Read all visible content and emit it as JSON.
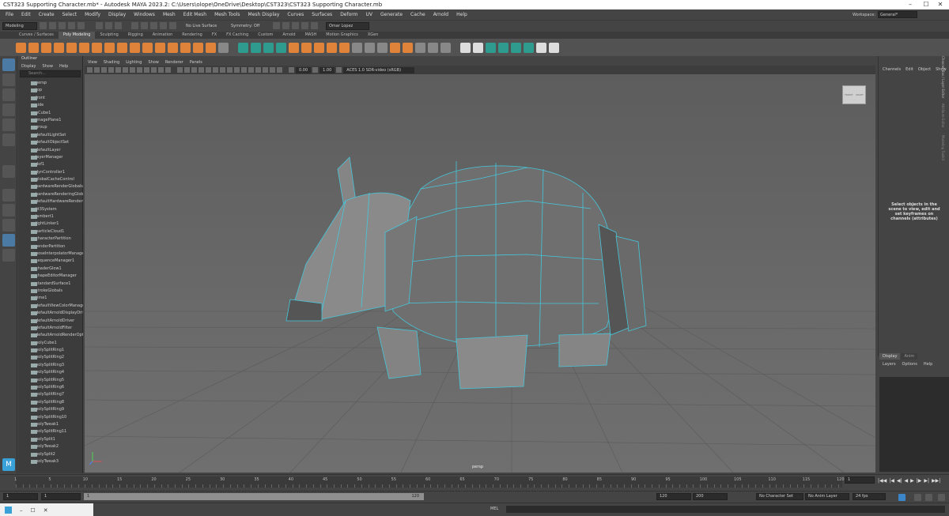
{
  "window": {
    "title": "CST323 Supporting Character.mb* - Autodesk MAYA 2023.2: C:\\Users\\olope\\OneDrive\\Desktop\\CST323\\CST323 Supporting Character.mb",
    "minimize": "–",
    "maximize": "☐",
    "close": "✕"
  },
  "menu": [
    "File",
    "Edit",
    "Create",
    "Select",
    "Modify",
    "Display",
    "Windows",
    "Mesh",
    "Edit Mesh",
    "Mesh Tools",
    "Mesh Display",
    "Curves",
    "Surfaces",
    "Deform",
    "UV",
    "Generate",
    "Cache",
    "Arnold",
    "Help"
  ],
  "workspace": {
    "label": "Workspace:",
    "value": "General*"
  },
  "statusline": {
    "mode": "Modeling",
    "live_surface": "No Live Surface",
    "symmetry": "Symmetry: Off",
    "user": "Omar Lopez"
  },
  "shelf_tabs": [
    "Curves / Surfaces",
    "Poly Modeling",
    "Sculpting",
    "Rigging",
    "Animation",
    "Rendering",
    "FX",
    "FX Caching",
    "Custom",
    "Arnold",
    "MASH",
    "Motion Graphics",
    "XGen"
  ],
  "shelf_active": "Poly Modeling",
  "outliner": {
    "title": "Outliner",
    "menu": [
      "Display",
      "Show",
      "Help"
    ],
    "search_placeholder": "Search...",
    "items": [
      "persp",
      "top",
      "front",
      "side",
      "pCube1",
      "imagePlane1",
      "group",
      "defaultLightSet",
      "defaultObjectSet",
      "defaultLayer",
      "layerManager",
      "dof1",
      "dynController1",
      "globalCacheControl",
      "hardwareRenderGlobals",
      "hardwareRenderingGlobals",
      "defaultHardwareRenderGlobals",
      "lit3System",
      "lambert1",
      "lightLinker1",
      "particleCloud1",
      "characterPartition",
      "renderPartition",
      "poseInterpolatorManager",
      "sequenceManager1",
      "shaderGlow1",
      "shapeEditorManager",
      "standardSurface1",
      "strokeGlobals",
      "time1",
      "defaultViewColorManager",
      "defaultArnoldDisplayDriver",
      "defaultArnoldDriver",
      "defaultArnoldFilter",
      "defaultArnoldRenderOptions",
      "polyCube1",
      "polySplitRing1",
      "polySplitRing2",
      "polySplitRing3",
      "polySplitRing4",
      "polySplitRing5",
      "polySplitRing6",
      "polySplitRing7",
      "polySplitRing8",
      "polySplitRing9",
      "polySplitRing10",
      "polyTweak1",
      "polySplitRing11",
      "polySplit1",
      "polyTweak2",
      "polySplit2",
      "polyTweak3"
    ]
  },
  "viewport": {
    "menu": [
      "View",
      "Shading",
      "Lighting",
      "Show",
      "Renderer",
      "Panels"
    ],
    "exposure": "0.00",
    "gamma": "1.00",
    "color_space": "ACES 1.0 SDR-video (sRGB)",
    "camera": "persp",
    "viewcube": [
      "FRONT",
      "RIGHT"
    ]
  },
  "channelbox": {
    "menu": [
      "Channels",
      "Edit",
      "Object",
      "Show"
    ],
    "hint": "Select objects in the scene to view, edit and set keyframes on channels (attributes)",
    "side_tabs": [
      "Channel Box / Layer Editor",
      "Attribute Editor",
      "Modeling Toolkit"
    ]
  },
  "layer_editor": {
    "tabs": [
      "Display",
      "Anim"
    ],
    "menu": [
      "Layers",
      "Options",
      "Help"
    ]
  },
  "timeline": {
    "ticks": [
      "1",
      "5",
      "10",
      "15",
      "20",
      "25",
      "30",
      "35",
      "40",
      "45",
      "50",
      "55",
      "60",
      "65",
      "70",
      "75",
      "80",
      "85",
      "90",
      "95",
      "100",
      "105",
      "110",
      "115",
      "120"
    ],
    "current_frame": "1",
    "playback": [
      "|◀◀",
      "|◀",
      "◀|",
      "◀",
      "▶",
      "|▶",
      "▶|",
      "▶▶|"
    ]
  },
  "range": {
    "start": "1",
    "start_inner": "1",
    "bar_start": "1",
    "bar_end": "120",
    "end_inner": "120",
    "end": "200",
    "character_set": "No Character Set",
    "anim_layer": "No Anim Layer",
    "fps": "24 fps"
  },
  "cmdline": {
    "lang": "MEL"
  }
}
